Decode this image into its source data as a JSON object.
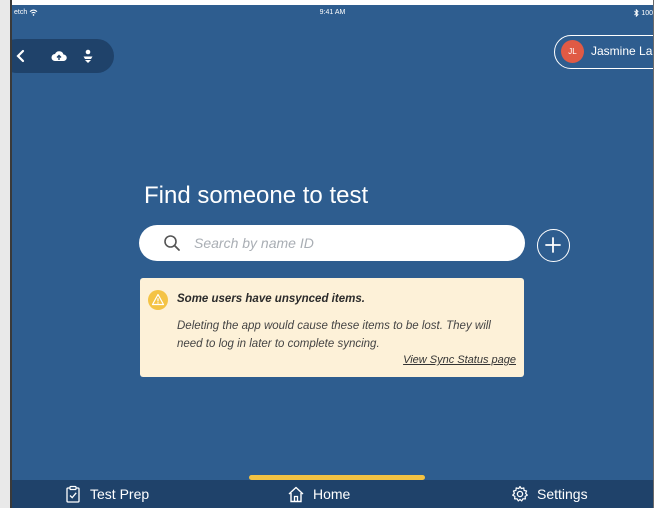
{
  "statusbar": {
    "carrier": "etch",
    "time": "9:41 AM",
    "battery": "100"
  },
  "user": {
    "initials": "JL",
    "name": "Jasmine La"
  },
  "main": {
    "heading": "Find someone to test",
    "search_placeholder": "Search by name ID"
  },
  "alert": {
    "title": "Some users have unsynced items.",
    "body": "Deleting the app would cause these items to be lost. They will need to log in later to complete syncing.",
    "link": "View Sync Status page"
  },
  "tabs": [
    {
      "label": "Test Prep",
      "icon": "clipboard-check-icon"
    },
    {
      "label": "Home",
      "icon": "home-icon",
      "active": true
    },
    {
      "label": "Settings",
      "icon": "gear-icon"
    }
  ],
  "colors": {
    "background": "#2e5d8f",
    "bar": "#1f426a",
    "accent": "#f2c243",
    "avatar": "#e05a45",
    "alert_bg": "#fdf1d8"
  }
}
